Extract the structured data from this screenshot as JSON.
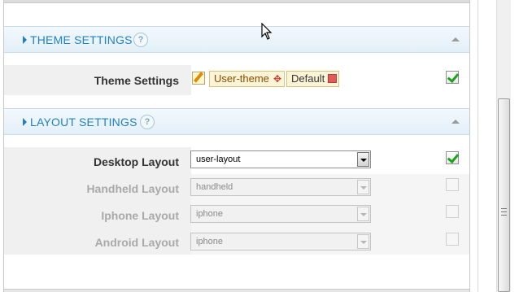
{
  "theme_section": {
    "title": "THEME SETTINGS",
    "help": "?",
    "row": {
      "label": "Theme Settings",
      "tags": [
        "User-theme",
        "Default"
      ],
      "checked": true
    }
  },
  "layout_section": {
    "title": "LAYOUT SETTINGS",
    "help": "?",
    "rows": [
      {
        "label": "Desktop Layout",
        "value": "user-layout",
        "enabled": true,
        "checked": true
      },
      {
        "label": "Handheld Layout",
        "value": "handheld",
        "enabled": false,
        "checked": false
      },
      {
        "label": "Iphone Layout",
        "value": "iphone",
        "enabled": false,
        "checked": false
      },
      {
        "label": "Android Layout",
        "value": "iphone",
        "enabled": false,
        "checked": false
      }
    ]
  },
  "colors": {
    "accent": "#1f82c4",
    "check": "#1ea11e",
    "tag_bg": "#fbf4d6"
  }
}
